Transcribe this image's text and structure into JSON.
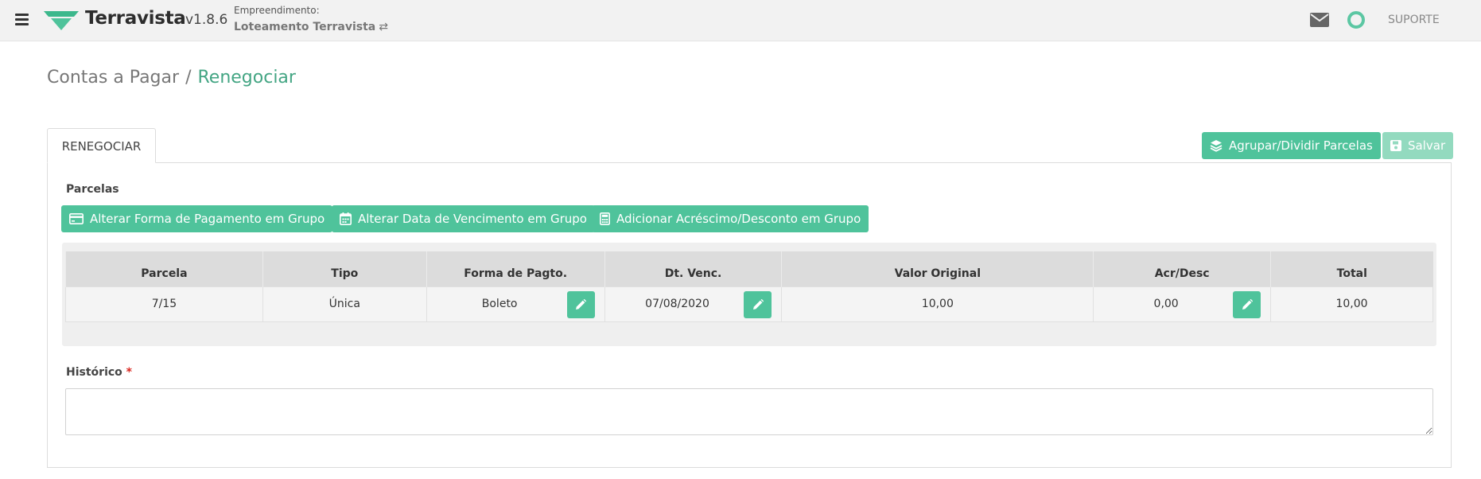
{
  "header": {
    "brand": "Terravista",
    "version": "v1.8.6",
    "empreendimento_label": "Empreendimento:",
    "empreendimento_value": "Loteamento Terravista",
    "swap_glyph": "⇄",
    "support_label": "SUPORTE",
    "accent_color": "#4fc39b"
  },
  "breadcrumb": {
    "parent": "Contas a Pagar",
    "separator": "/",
    "current": "Renegociar"
  },
  "tabs": [
    {
      "label": "RENEGOCIAR",
      "active": true
    }
  ],
  "actions": {
    "group_split_label": "Agrupar/Dividir Parcelas",
    "save_label": "Salvar"
  },
  "parcelas": {
    "title": "Parcelas",
    "buttons": {
      "payment_method": "Alterar Forma de Pagamento em Grupo",
      "due_date": "Alterar Data de Vencimento em Grupo",
      "surcharge_discount": "Adicionar Acréscimo/Desconto em Grupo"
    },
    "columns": [
      "Parcela",
      "Tipo",
      "Forma de Pagto.",
      "Dt. Venc.",
      "Valor Original",
      "Acr/Desc",
      "Total"
    ],
    "rows": [
      {
        "parcela": "7/15",
        "tipo": "Única",
        "forma": "Boleto",
        "vencimento": "07/08/2020",
        "valor_original": "10,00",
        "acr_desc": "0,00",
        "total": "10,00"
      }
    ]
  },
  "historico": {
    "label": "Histórico",
    "required_mark": "*",
    "value": ""
  }
}
